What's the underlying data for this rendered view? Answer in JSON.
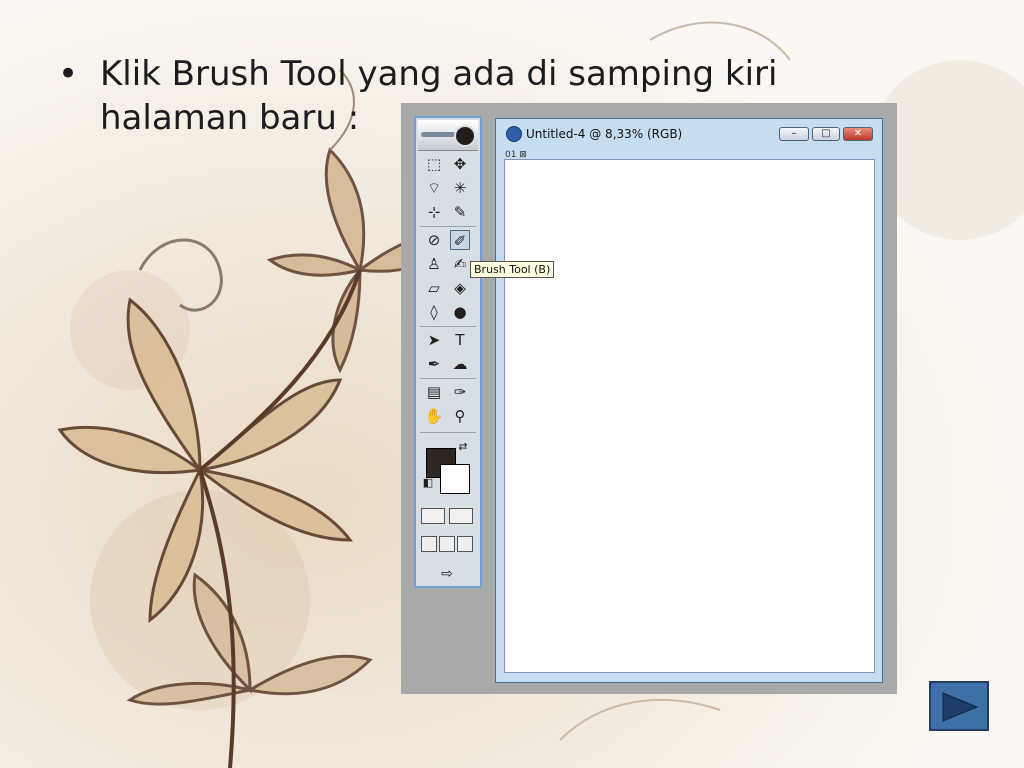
{
  "slide": {
    "bullet_char": "•",
    "bullet_text": "Klik Brush Tool yang ada di samping kiri halaman baru :"
  },
  "screenshot": {
    "doc_window": {
      "title": "Untitled-4 @ 8,33% (RGB)",
      "ruler_tabs": "01 ⊠",
      "minimize": "–",
      "restore": "□",
      "close": "✕"
    },
    "tooltip": "Brush Tool (B)",
    "colors": {
      "foreground": "#2e2620",
      "background": "#ffffff",
      "toolbox_border": "#6e9fd0"
    }
  },
  "nav": {
    "next_icon": "play-right-icon"
  }
}
